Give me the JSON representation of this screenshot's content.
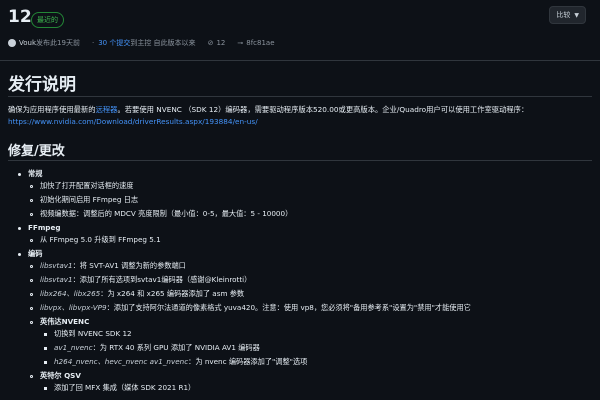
{
  "release": {
    "tag": "12",
    "badge": "最近的",
    "compare_label": "比较"
  },
  "meta": {
    "author": "Vouk",
    "published": "发布此19天前",
    "commits_link": "30 个提交",
    "commits_suffix": "到主控 自此版本以来",
    "tag_label": "12",
    "commit_hash": "8fc81ae"
  },
  "notes": {
    "title": "发行说明",
    "para_prefix": "确保为应用程序使用最新的",
    "para_link": "远程器",
    "para_rest": "。若要使用 NVENC （SDK 12）编码器，需要驱动程序版本520.00或更高版本。企业/Quadro用户可以使用工作室驱动程序：",
    "para_url": "https://www.nvidia.com/Download/driverResults.aspx/193884/en-us/"
  },
  "fixes": {
    "title": "修复/更改",
    "general_title": "常规",
    "general_items": [
      "加快了打开配置对话框的速度",
      "初始化期间启用 FFmpeg 日志",
      "视频编数据：调整后的 MDCV 亮度限制（最小值：0-5，最大值：5 - 10000）"
    ],
    "ffmpeg_title": "FFmpeg",
    "ffmpeg_items": [
      "从 FFmpeg 5.0 升级到 FFmpeg 5.1"
    ],
    "encoder_title": "编码",
    "enc1_code": "libsvtav1",
    "enc1_text": "：将 SVT-AV1 调整为新的参数端口",
    "enc2_code": "libsvtav1",
    "enc2_text": "：添加了所有选项到svtav1编码器（感谢@Kleinrotti）",
    "enc3_code": "libx264、libx265",
    "enc3_text": "：为 x264 和 x265 编码器添加了 asm 参数",
    "enc4_code": "libvpx、libvpx-VP9",
    "enc4_text": "：添加了支持阿尔法通道的像素格式 yuva420。注意：使用 vp8，您必须将\"备用参考系\"设置为\"禁用\"才能使用它",
    "nvenc_title": "英伟达NVENC",
    "nvenc1_text": "切换到 NVENC SDK 12",
    "nvenc2_code": "av1_nvenc",
    "nvenc2_text": "：为 RTX 40 系列 GPU 添加了 NVIDIA AV1 编码器",
    "nvenc3_code": "h264_nvenc、hevc_nvenc av1_nvenc",
    "nvenc3_text": "：为 nvenc 编码器添加了\"调整\"选项",
    "qsv_title": "英特尔 QSV",
    "qsv1_text": "添加了回 MFX 集成（媒体 SDK 2021 R1）"
  }
}
